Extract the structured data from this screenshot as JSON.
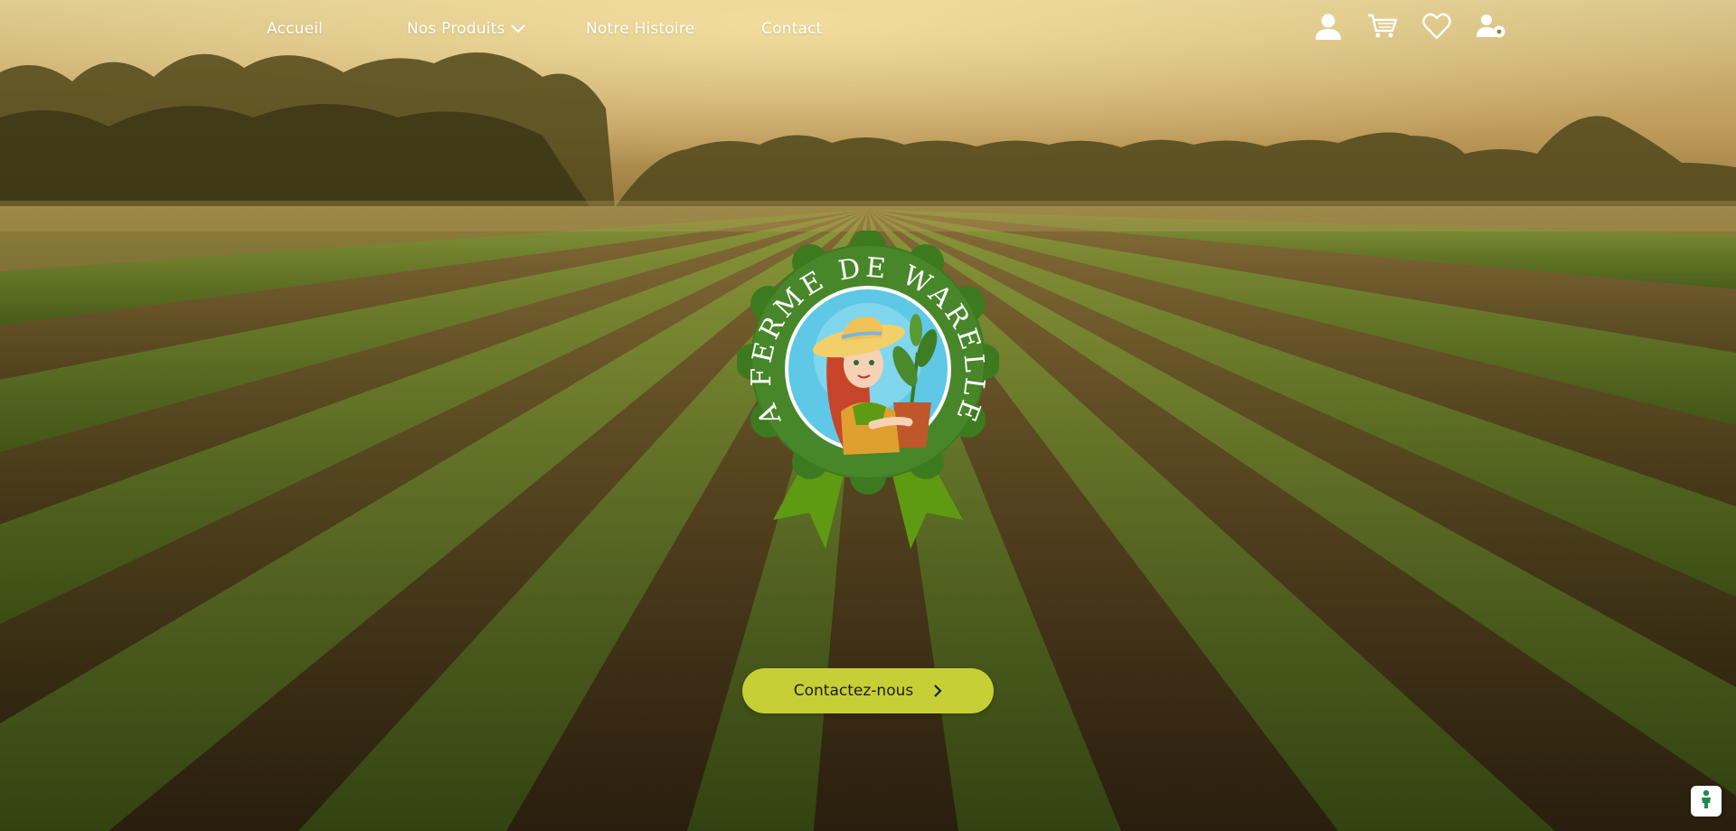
{
  "nav": {
    "links": [
      {
        "label": "Accueil"
      },
      {
        "label": "Nos Produits",
        "has_dropdown": true
      },
      {
        "label": "Notre Histoire"
      },
      {
        "label": "Contact"
      }
    ],
    "icons": [
      "user-icon",
      "cart-icon",
      "heart-icon",
      "account-settings-icon"
    ]
  },
  "logo": {
    "brand_text": "LA FERME DE WARELLES",
    "colors": {
      "badge": "#3d7a1f",
      "ribbon": "#5e9b12",
      "inner": "#5ec8e6"
    }
  },
  "hero": {
    "cta_label": "Contactez-nous",
    "cta_icon": "chevron-right-icon",
    "cta_color": "#c7cf36"
  },
  "privacy": {
    "icon": "privacy-person-icon",
    "accent": "#1f8a4c"
  }
}
